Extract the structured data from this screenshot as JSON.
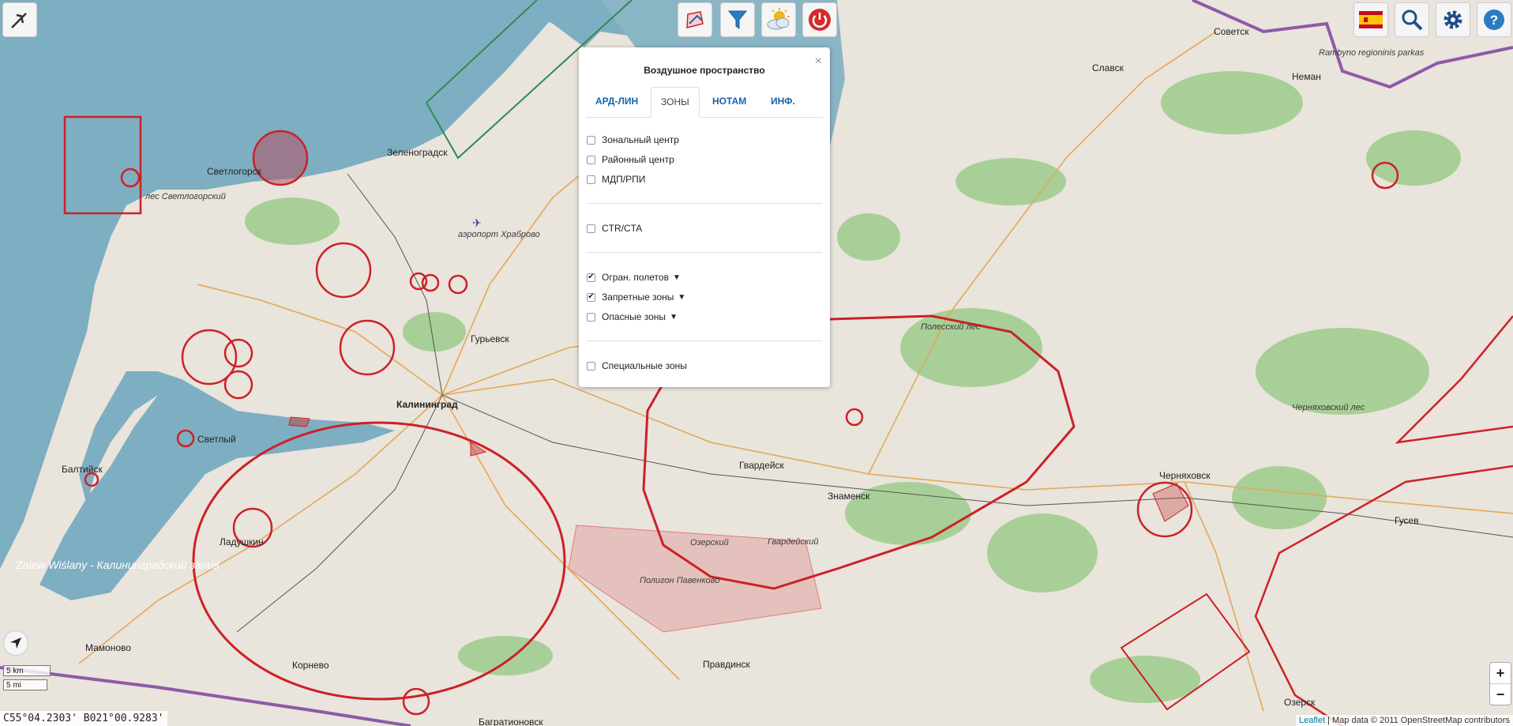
{
  "map": {
    "places": {
      "sovetsk": "Советск",
      "slavsk": "Славск",
      "neman": "Неман",
      "rambyno": "Rambyno regioninis parkas",
      "zelenogradsk": "Зеленоградск",
      "svetlogorsk": "Светлогорск",
      "les_svetlogorsky": "лес Светлогорский",
      "airport": "аэропорт Храброво",
      "guryevsk": "Гурьевск",
      "kaliningrad": "Калининград",
      "polessky_les": "Полесский лес",
      "svetly": "Светлый",
      "baltiysk": "Балтийск",
      "gvardeysk": "Гвардейск",
      "znamensk": "Знаменск",
      "chernyakhovsk": "Черняховск",
      "chernyakhovsky_les": "Черняховский лес",
      "gusev": "Гусев",
      "ozersky": "Озерский",
      "gvardeysky": "Гвардейский",
      "poligon": "Полигон Павенково",
      "ladushkin": "Ладушкин",
      "zalew": "Zalew Wiślany - Калининградский залив",
      "mamonovo": "Мамоново",
      "korneve": "Корнево",
      "pravdinsk": "Правдинск",
      "bagrationovsk": "Багратионовск",
      "ozersk": "Озерск"
    }
  },
  "toolbar": {
    "left_icon": "aircraft-icon",
    "center_icons": [
      "airspace-icon",
      "filter-icon",
      "weather-icon",
      "power-icon"
    ],
    "right_icons": [
      "flag-icon",
      "search-icon",
      "gear-icon",
      "help-icon"
    ]
  },
  "panel": {
    "title": "Воздушное пространство",
    "close": "×",
    "tabs": [
      {
        "label": "АРД-ЛИН",
        "active": false
      },
      {
        "label": "ЗОНЫ",
        "active": true
      },
      {
        "label": "НОТАМ",
        "active": false
      },
      {
        "label": "ИНФ.",
        "active": false
      }
    ],
    "group1": [
      {
        "label": "Зональный центр",
        "checked": false
      },
      {
        "label": "Районный центр",
        "checked": false
      },
      {
        "label": "МДП/РПИ",
        "checked": false
      }
    ],
    "group2": [
      {
        "label": "CTR/CTA",
        "checked": false
      }
    ],
    "group3": [
      {
        "label": "Огран. полетов",
        "checked": true,
        "filter": true
      },
      {
        "label": "Запретные зоны",
        "checked": true,
        "filter": true
      },
      {
        "label": "Опасные зоны",
        "checked": false,
        "filter": true
      }
    ],
    "group4": [
      {
        "label": "Специальные зоны",
        "checked": false
      }
    ]
  },
  "scale": {
    "km": "5 km",
    "mi": "5 mi"
  },
  "coordinates": "C55°04.2303' B021°00.9283'",
  "zoom": {
    "in": "+",
    "out": "−"
  },
  "attribution": {
    "leaflet": "Leaflet",
    "text": " | Map data © 2011 OpenStreetMap contributors"
  },
  "colors": {
    "sea": "#7eaec1",
    "land": "#e9e4dc",
    "forest": "#a6cf95",
    "zone": "#cc2127",
    "border": "#8e5aa6"
  }
}
